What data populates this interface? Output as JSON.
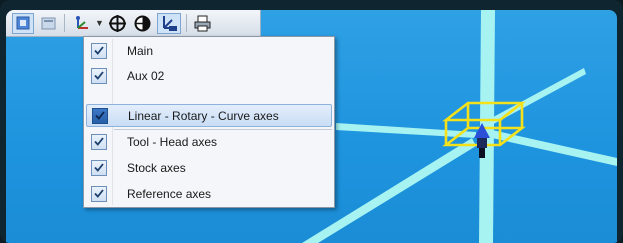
{
  "toolbar": {
    "buttons": [
      {
        "icon": "view-cube-icon",
        "active": true
      },
      {
        "icon": "panel-icon",
        "active": false
      },
      {
        "icon": "axes-icon",
        "active": false,
        "has_dropdown": true
      },
      {
        "icon": "target-icon",
        "active": false
      },
      {
        "icon": "section-icon",
        "active": false
      },
      {
        "icon": "vcs-icon",
        "active": true
      },
      {
        "icon": "print-icon",
        "active": false
      }
    ]
  },
  "menu": {
    "items": [
      {
        "label": "Main",
        "checked": true
      },
      {
        "label": "Aux 02",
        "checked": true
      },
      {
        "label": "Linear - Rotary - Curve axes",
        "checked": true,
        "highlighted": true
      },
      {
        "label": "Tool - Head axes",
        "checked": true
      },
      {
        "label": "Stock axes",
        "checked": true
      },
      {
        "label": "Reference axes",
        "checked": true
      }
    ]
  },
  "colors": {
    "viewport_bg": "#2fa0e4",
    "axis_line": "#a6f3f2",
    "bounding_box": "#f5e11a",
    "head_marker": "#2b4fd6"
  }
}
